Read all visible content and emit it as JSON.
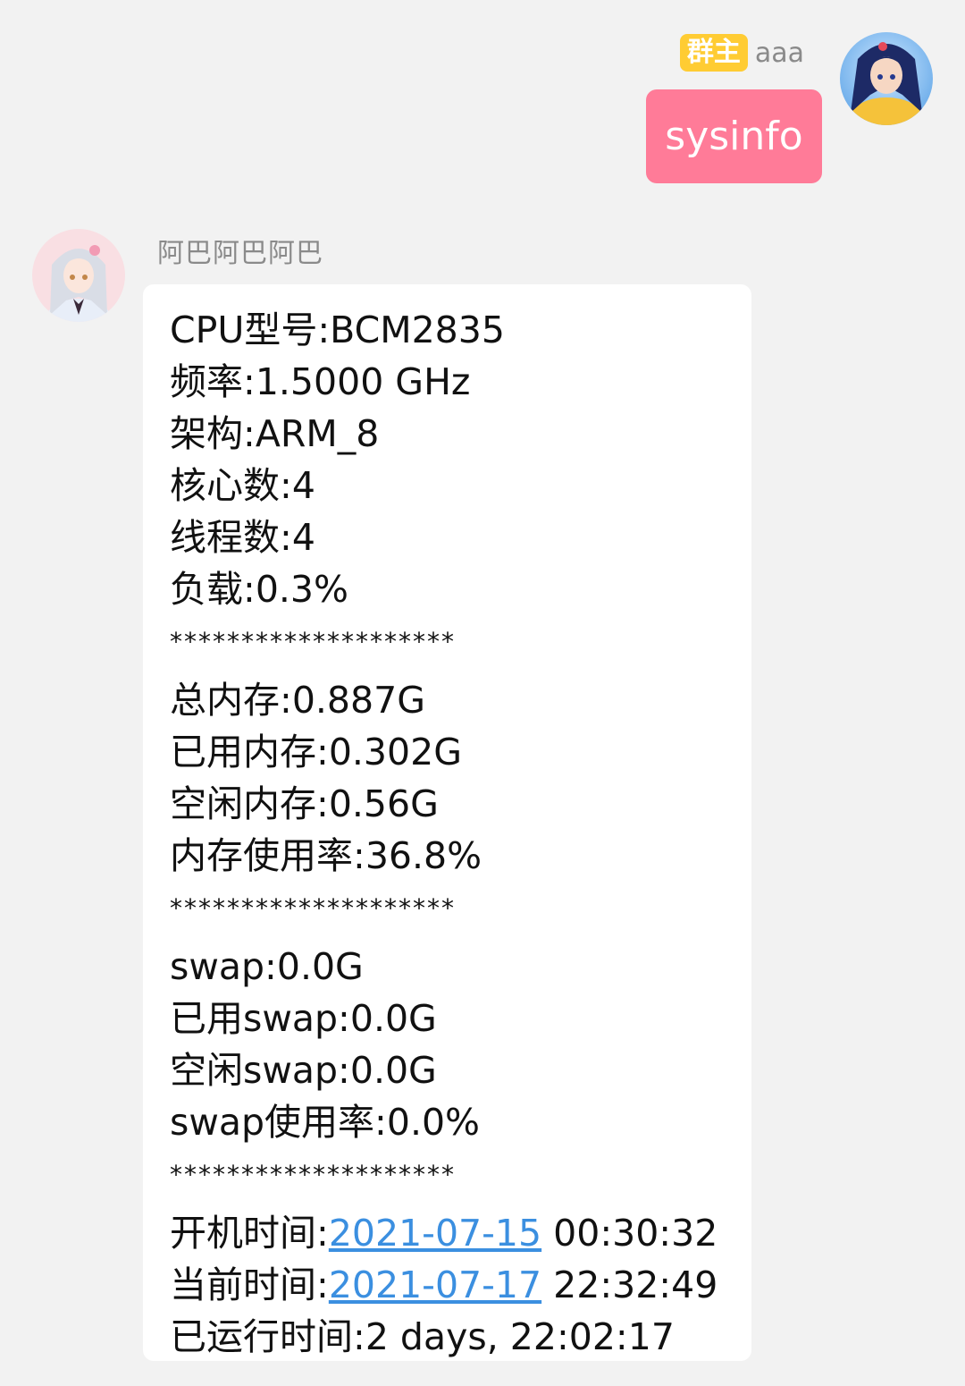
{
  "self_message": {
    "badge": "群主",
    "name": "aaa",
    "text": "sysinfo"
  },
  "bot_message": {
    "name": "阿巴阿巴阿巴",
    "cpu": [
      "CPU型号:BCM2835",
      "频率:1.5000 GHz",
      "架构:ARM_8",
      "核心数:4",
      "线程数:4",
      "负载:0.3%"
    ],
    "separator": "********************",
    "memory": [
      "总内存:0.887G",
      "已用内存:0.302G",
      "空闲内存:0.56G",
      "内存使用率:36.8%"
    ],
    "swap": [
      "swap:0.0G",
      "已用swap:0.0G",
      "空闲swap:0.0G",
      "swap使用率:0.0%"
    ],
    "boot": {
      "label": "开机时间:",
      "date": "2021-07-15",
      "time": " 00:30:32"
    },
    "now": {
      "label": "当前时间:",
      "date": "2021-07-17",
      "time": " 22:32:49"
    },
    "uptime": "已运行时间:2 days, 22:02:17"
  },
  "colors": {
    "background": "#f2f2f2",
    "self_bubble": "#ff7b98",
    "badge": "#ffcc33",
    "link": "#3b8fe0"
  },
  "icons": {
    "self_avatar": "anime-avatar-dark-hair",
    "bot_avatar": "anime-avatar-silver-hair"
  }
}
